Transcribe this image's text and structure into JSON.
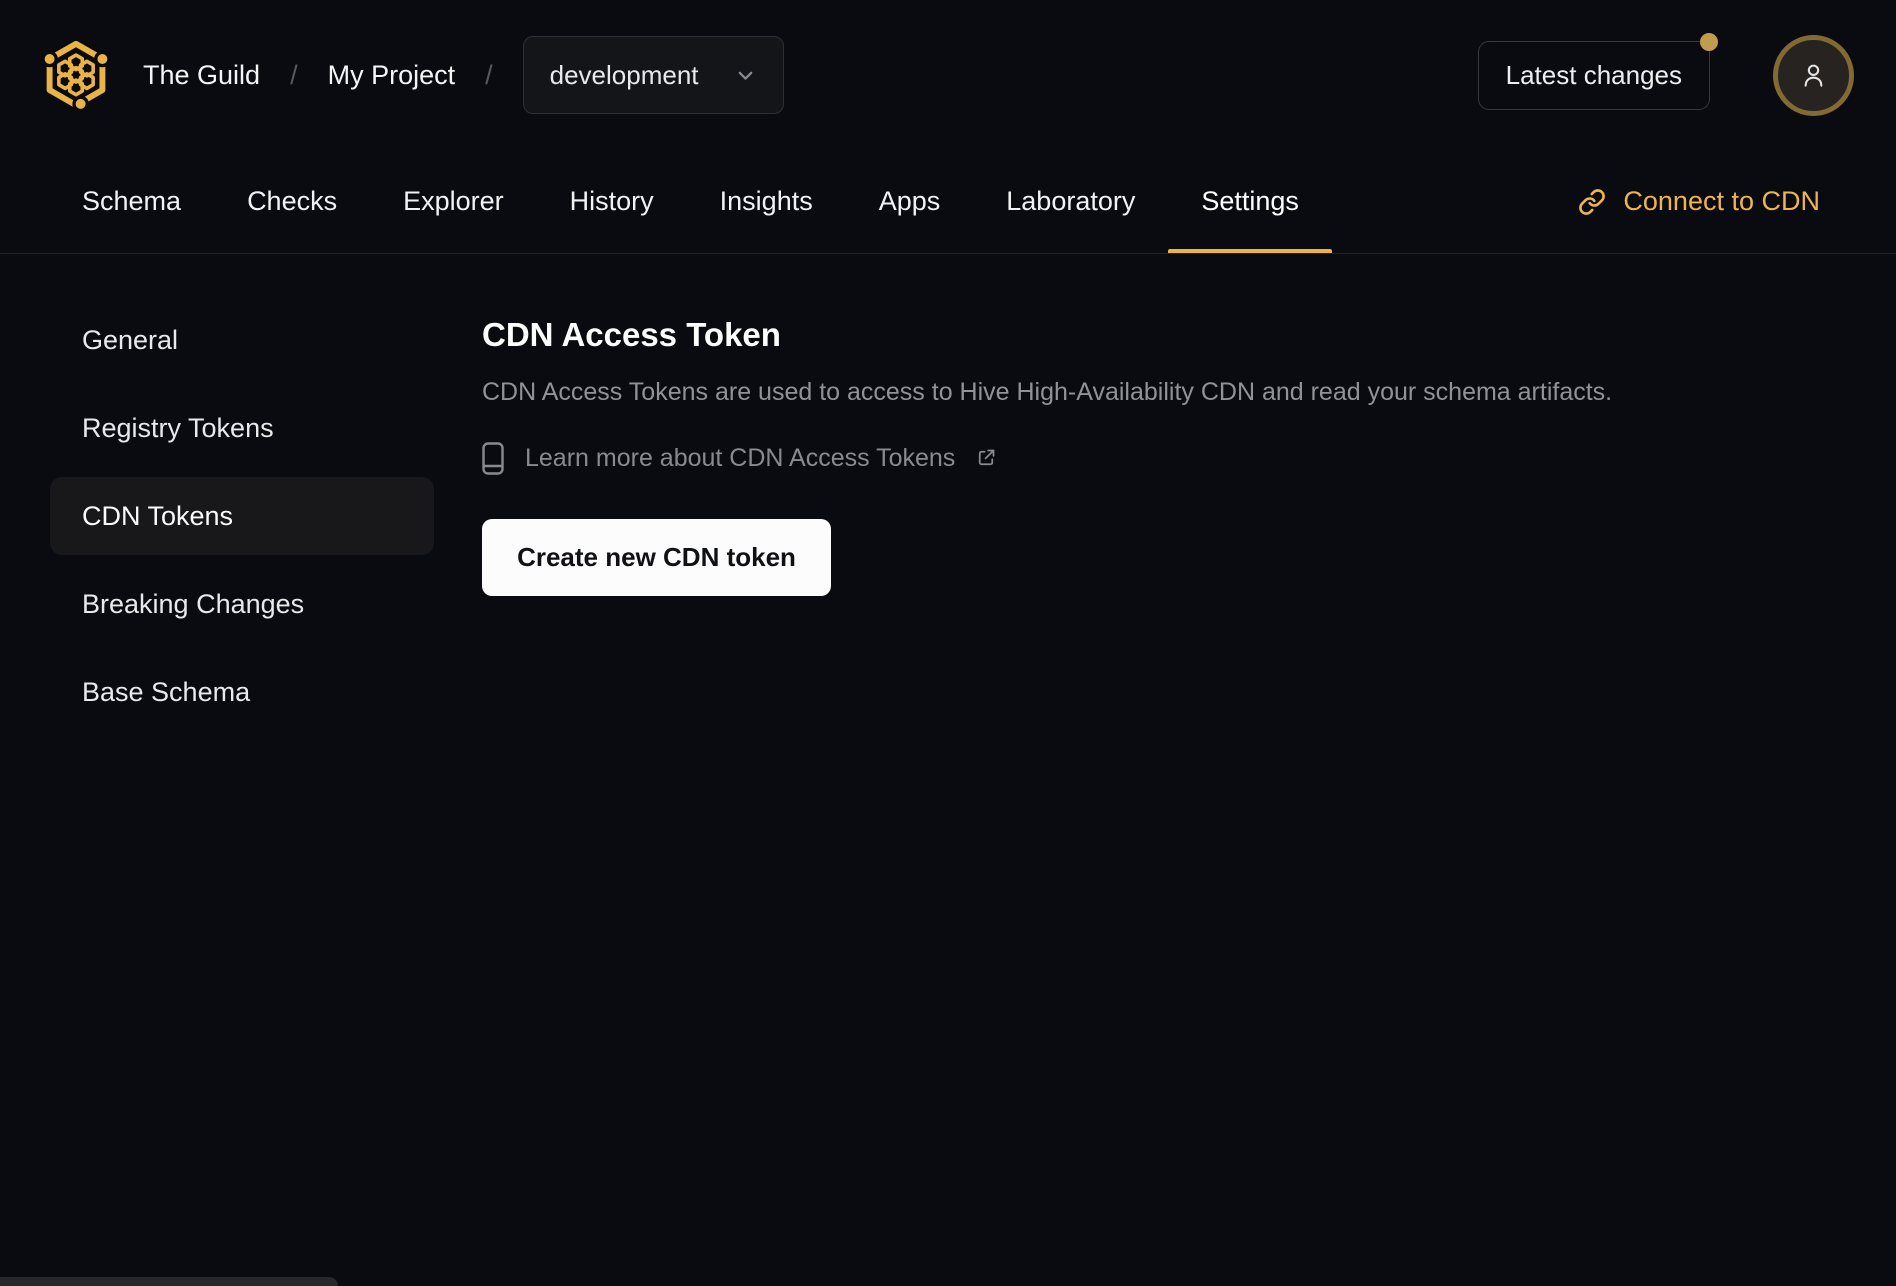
{
  "header": {
    "logo_icon": "hive-honeycomb-logo",
    "breadcrumb": {
      "org": "The Guild",
      "separator": "/",
      "project": "My Project"
    },
    "target_selector": {
      "value": "development",
      "icon": "chevron-down-icon"
    },
    "latest_changes": {
      "label": "Latest changes",
      "has_notification_dot": true
    },
    "user_menu": {
      "icon": "user-icon"
    }
  },
  "tabs": {
    "items": [
      "Schema",
      "Checks",
      "Explorer",
      "History",
      "Insights",
      "Apps",
      "Laboratory",
      "Settings"
    ],
    "active": "Settings",
    "connect_cdn": {
      "label": "Connect to CDN",
      "icon": "link-icon"
    }
  },
  "sidebar": {
    "items": [
      "General",
      "Registry Tokens",
      "CDN Tokens",
      "Breaking Changes",
      "Base Schema"
    ],
    "active": "CDN Tokens"
  },
  "main": {
    "title": "CDN Access Token",
    "description": "CDN Access Tokens are used to access to Hive High-Availability CDN and read your schema artifacts.",
    "learn_more": {
      "label": "Learn more about CDN Access Tokens",
      "leading_icon": "book-icon",
      "trailing_icon": "external-link-icon"
    },
    "create_button": {
      "label": "Create new CDN token"
    }
  },
  "colors": {
    "background": "#0a0b10",
    "accent_gold": "#e9b345",
    "active_tab_underline": "#edb23f",
    "connect_cdn_text": "#efb44e",
    "notification_dot": "#bf9c4e",
    "sidebar_active_bg": "#18181b",
    "primary_button_bg": "#fcfcfc",
    "primary_button_text": "#101114",
    "muted_text": "#8f9298"
  }
}
